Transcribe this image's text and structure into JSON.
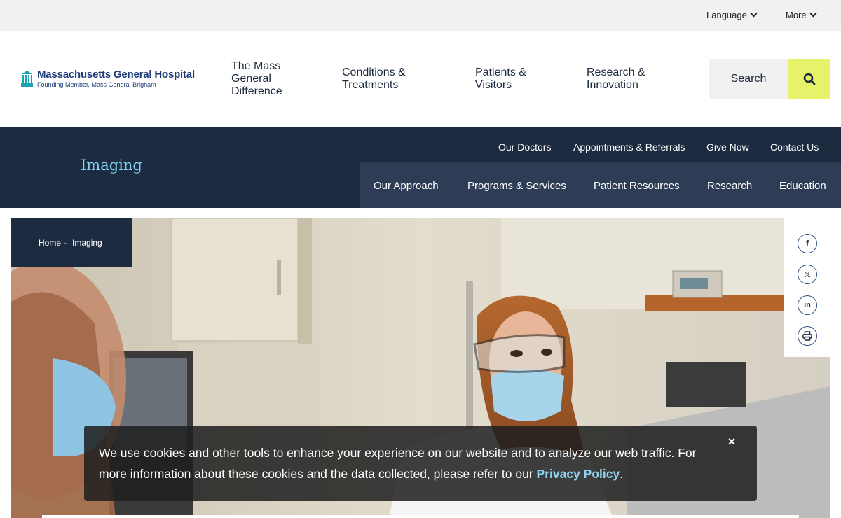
{
  "utility": {
    "language": "Language",
    "more": "More"
  },
  "logo": {
    "name": "Massachusetts General Hospital",
    "tagline": "Founding Member, Mass General Brigham"
  },
  "main_nav": [
    {
      "label": "The Mass General Difference",
      "lines": [
        "The Mass",
        "General",
        "Difference"
      ]
    },
    {
      "label": "Conditions & Treatments",
      "lines": [
        "Conditions &",
        "Treatments"
      ]
    },
    {
      "label": "Patients & Visitors",
      "lines": [
        "Patients &",
        "Visitors"
      ]
    },
    {
      "label": "Research & Innovation",
      "lines": [
        "Research &",
        "Innovation"
      ]
    }
  ],
  "search": {
    "label": "Search"
  },
  "department": {
    "title": "Imaging",
    "top_links": [
      "Our Doctors",
      "Appointments & Referrals",
      "Give Now",
      "Contact Us"
    ],
    "sub_links": [
      "Our Approach",
      "Programs & Services",
      "Patient Resources",
      "Research",
      "Education"
    ]
  },
  "breadcrumb": {
    "home": "Home",
    "separator": "-",
    "current": "Imaging"
  },
  "social": {
    "facebook": "f",
    "x": "𝕏",
    "linkedin": "in"
  },
  "cookie": {
    "text_before": "We use cookies and other tools to enhance your experience on our website and to analyze our web traffic. For more information about these cookies and the data collected, please refer to our ",
    "link": "Privacy Policy",
    "text_after": ".",
    "close": "×"
  },
  "colors": {
    "navy": "#1d2b40",
    "accent_yellow": "#e6f36a",
    "title_blue": "#7fd2f0"
  }
}
